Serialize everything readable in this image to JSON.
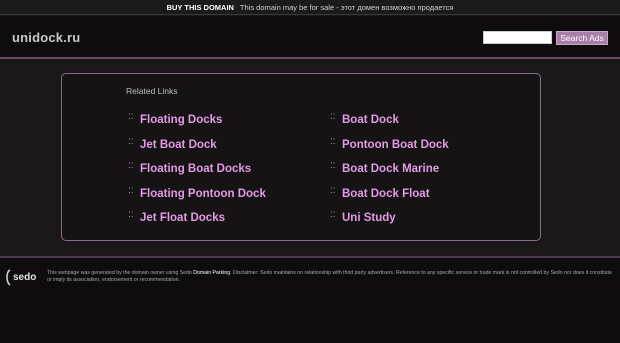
{
  "topbar": {
    "buy_label": "BUY THIS DOMAIN",
    "message": "This domain may be for sale - этот домен возможно продается"
  },
  "header": {
    "site_name": "unidock.ru",
    "search_placeholder": "",
    "search_button": "Search Ads"
  },
  "related": {
    "title": "Related Links",
    "left": [
      {
        "label": "Floating Docks"
      },
      {
        "label": "Jet Boat Dock"
      },
      {
        "label": "Floating Boat Docks"
      },
      {
        "label": "Floating Pontoon Dock"
      },
      {
        "label": "Jet Float Docks"
      }
    ],
    "right": [
      {
        "label": "Boat Dock"
      },
      {
        "label": "Pontoon Boat Dock"
      },
      {
        "label": "Boat Dock Marine"
      },
      {
        "label": "Boat Dock Float"
      },
      {
        "label": "Uni Study"
      }
    ],
    "bullet": "::"
  },
  "footer": {
    "logo_text": "sedo",
    "text_before": "This webpage was generated by the domain owner using Sedo ",
    "domain_parking": "Domain Parking",
    "text_after": ". Disclaimer: Sedo maintains no relationship with third party advertisers. Reference to any specific service or trade mark is not controlled by Sedo nor does it constitute or imply its association, endorsement or recommendation."
  },
  "colors": {
    "accent": "#a87eaa",
    "link": "#e39be6",
    "background": "#1a1718",
    "border": "#8c6a8e"
  }
}
